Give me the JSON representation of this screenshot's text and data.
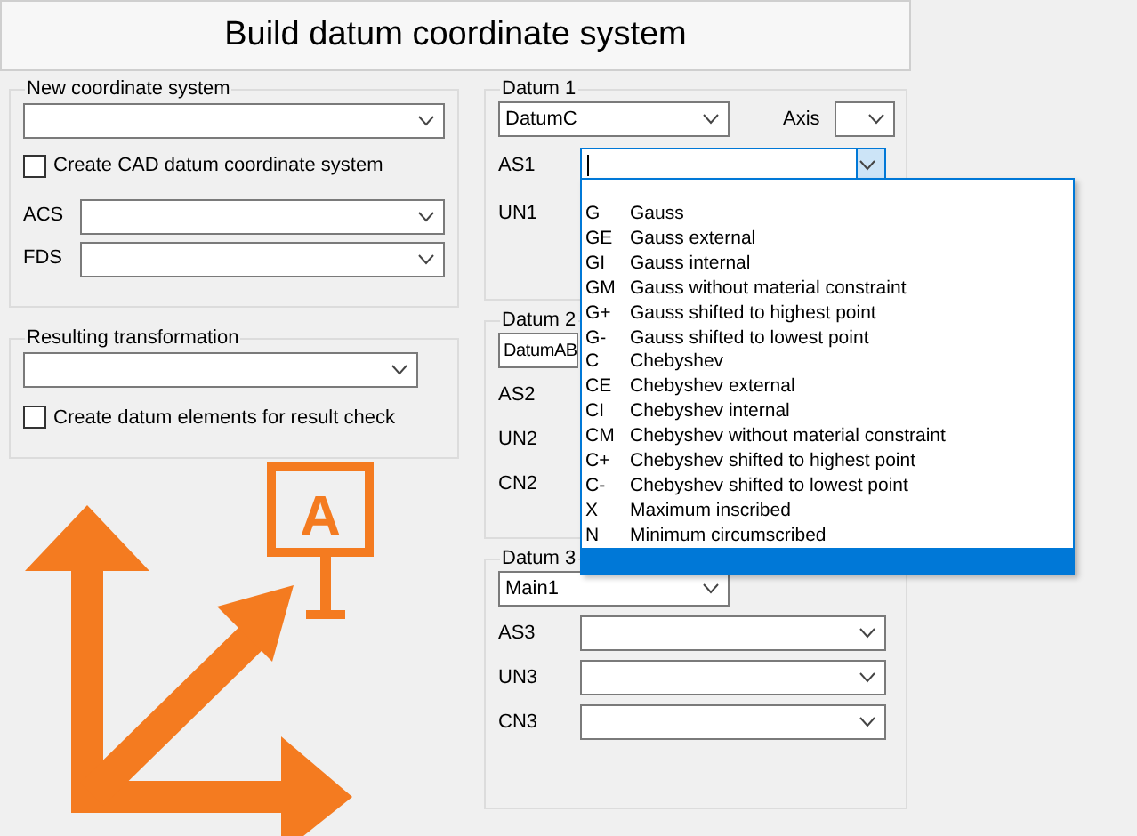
{
  "window": {
    "title": "Build datum coordinate system"
  },
  "new_coordinate_system": {
    "label": "New coordinate system",
    "checkbox": {
      "label": "Create CAD datum coordinate system",
      "checked": false
    },
    "fields": [
      {
        "label": "ACS"
      },
      {
        "label": "FDS"
      }
    ]
  },
  "resulting_transformation": {
    "label": "Resulting transformation",
    "checkbox": {
      "label": "Create datum elements for result check",
      "checked": false
    }
  },
  "logo": {
    "letter": "A"
  },
  "datums": [
    {
      "title": "Datum 1",
      "value": "DatumC",
      "axis_label": "Axis",
      "rows": [
        {
          "label": "AS1",
          "kind": "field",
          "focused": true
        },
        {
          "label": "UN1",
          "kind": "label"
        }
      ]
    },
    {
      "title": "Datum 2",
      "value": "DatumAB",
      "rows": [
        {
          "label": "AS2",
          "kind": "label"
        },
        {
          "label": "UN2",
          "kind": "label"
        },
        {
          "label": "CN2",
          "kind": "label"
        }
      ]
    },
    {
      "title": "Datum 3",
      "value": "Main1",
      "rows": [
        {
          "label": "AS3",
          "kind": "field",
          "focused": false
        },
        {
          "label": "UN3",
          "kind": "field",
          "focused": false
        },
        {
          "label": "CN3",
          "kind": "field",
          "focused": false
        }
      ]
    }
  ],
  "dropdown_list": {
    "items": [
      {
        "code": "G",
        "name": "Gauss",
        "selected": false
      },
      {
        "code": "GE",
        "name": "Gauss external",
        "selected": false
      },
      {
        "code": "GI",
        "name": "Gauss internal",
        "selected": false
      },
      {
        "code": "GM",
        "name": "Gauss without material constraint",
        "selected": false
      },
      {
        "code": "G+",
        "name": "Gauss shifted to highest point",
        "selected": false
      },
      {
        "code": "G-",
        "name": "Gauss shifted to lowest point",
        "selected": false
      },
      {
        "code": "C",
        "name": "Chebyshev",
        "selected": false
      },
      {
        "code": "CE",
        "name": "Chebyshev external",
        "selected": false
      },
      {
        "code": "CI",
        "name": "Chebyshev internal",
        "selected": false
      },
      {
        "code": "CM",
        "name": "Chebyshev without material constraint",
        "selected": false
      },
      {
        "code": "C+",
        "name": "Chebyshev shifted to highest point",
        "selected": false
      },
      {
        "code": "C-",
        "name": "Chebyshev shifted to lowest point",
        "selected": false
      },
      {
        "code": "X",
        "name": "Maximum inscribed",
        "selected": false
      },
      {
        "code": "N",
        "name": "Minimum circumscribed",
        "selected": false
      },
      {
        "selected": true
      }
    ]
  }
}
